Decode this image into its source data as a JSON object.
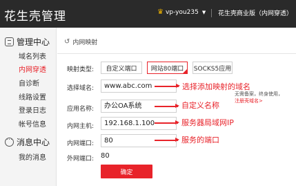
{
  "header": {
    "brand": "花生壳管理",
    "account": "vp-you235",
    "edition": "花生壳商业版（内网穿透）"
  },
  "sidebar": {
    "sections": [
      {
        "title": "管理中心",
        "items": [
          {
            "label": "域名列表",
            "active": false
          },
          {
            "label": "内网穿透",
            "active": true
          },
          {
            "label": "自诊断",
            "active": false
          },
          {
            "label": "线路设置",
            "active": false
          },
          {
            "label": "登录日志",
            "active": false
          },
          {
            "label": "帐号信息",
            "active": false
          }
        ]
      },
      {
        "title": "消息中心",
        "items": [
          {
            "label": "我的消息",
            "active": false
          }
        ]
      }
    ]
  },
  "main": {
    "breadcrumb": "内网映射",
    "form": {
      "type_label": "映射类型:",
      "type_options": [
        "自定义端口",
        "网站80端口",
        "SOCKS5应用"
      ],
      "type_selected": "网站80端口",
      "domain_label": "选择域名:",
      "domain_value": "www.abc.com",
      "app_label": "应用名称:",
      "app_value": "办公OA系统",
      "host_label": "内网主机:",
      "host_value": "192.168.1.100",
      "port_label": "内网端口:",
      "port_value": "80",
      "ext_port_label": "外网端口:",
      "ext_port_value": "80",
      "confirm_label": "确定"
    },
    "annotations": {
      "domain": "选择添加映射的域名",
      "app": "自定义名称",
      "host": "服务器局域网IP",
      "port": "服务的端口"
    },
    "tip": {
      "text": "无需备案，终身使用，",
      "link": "注册壳域名>"
    }
  },
  "colors": {
    "accent": "#e8232a",
    "header_bg": "#2a2a2a",
    "sidebar_bg": "#f4f4f4"
  }
}
